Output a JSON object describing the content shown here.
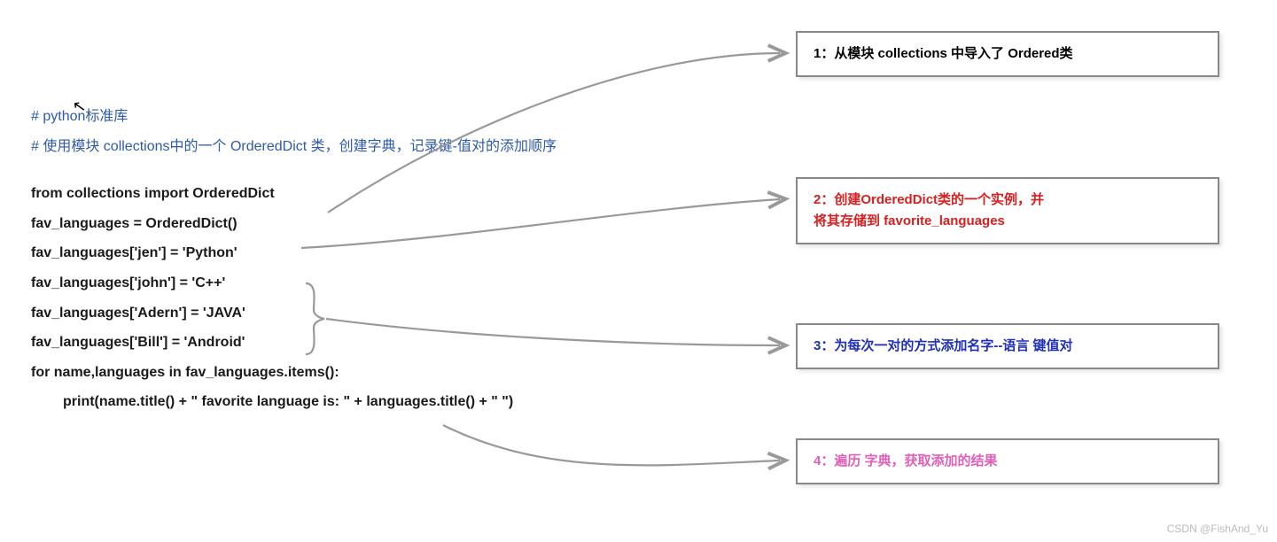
{
  "cursor_glyph": "↖",
  "comments": {
    "c1": "# python标准库",
    "c2": "# 使用模块 collections中的一个 OrderedDict 类，创建字典，记录键-值对的添加顺序"
  },
  "code": {
    "l1": "from collections import OrderedDict",
    "l2": "fav_languages = OrderedDict()",
    "l3": "fav_languages['jen'] = 'Python'",
    "l4": "fav_languages['john'] = 'C++'",
    "l5": "fav_languages['Adern'] = 'JAVA'",
    "l6": "fav_languages['Bill'] = 'Android'",
    "l7": "for name,languages in fav_languages.items():",
    "l8": "print(name.title() + \" favorite language is: \" + languages.title() + \" \")"
  },
  "annotations": {
    "a1": "1：从模块 collections 中导入了 Ordered类",
    "a2_l1": "2：创建OrderedDict类的一个实例，并",
    "a2_l2": "将其存储到 favorite_languages",
    "a3": "3：为每次一对的方式添加名字--语言 键值对",
    "a4": "4：遍历 字典，获取添加的结果"
  },
  "watermark": "CSDN @FishAnd_Yu"
}
